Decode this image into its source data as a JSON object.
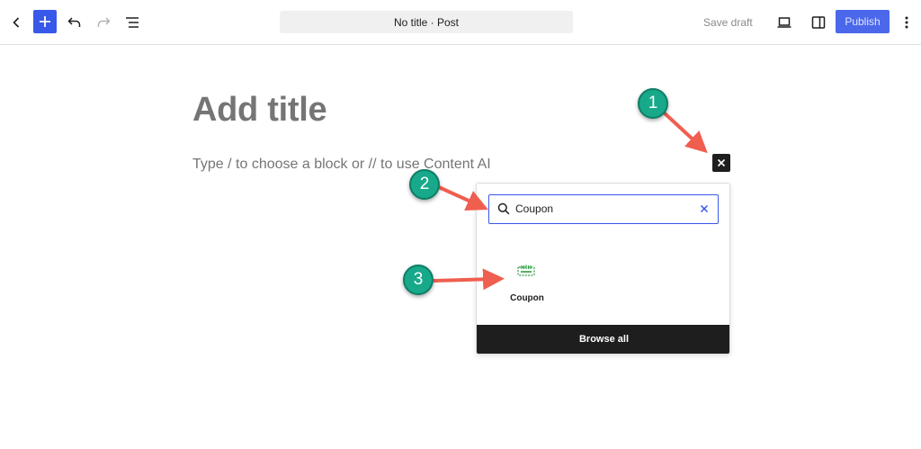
{
  "toolbar": {
    "document_title": "No title · Post",
    "save_draft_label": "Save draft",
    "publish_label": "Publish",
    "accent_color": "#3858e9"
  },
  "icons": {
    "back": "chevron-left-icon",
    "inserter": "plus-icon",
    "undo": "undo-icon",
    "redo": "redo-icon",
    "document_overview": "list-view-icon",
    "preview": "laptop-icon",
    "settings": "sidebar-icon",
    "options": "kebab-menu-icon",
    "close": "close-icon",
    "search": "search-icon",
    "clear": "clear-icon",
    "block": "coupon-block-icon"
  },
  "editor": {
    "title_placeholder": "Add title",
    "block_placeholder": "Type / to choose a block or // to use Content AI"
  },
  "quick_inserter": {
    "search_value": "Coupon",
    "results": [
      {
        "label": "Coupon"
      }
    ],
    "browse_all_label": "Browse all"
  },
  "annotations": {
    "badge_1": "1",
    "badge_2": "2",
    "badge_3": "3",
    "badge_color": "#17a98a",
    "arrow_color": "#ef5e4f"
  }
}
